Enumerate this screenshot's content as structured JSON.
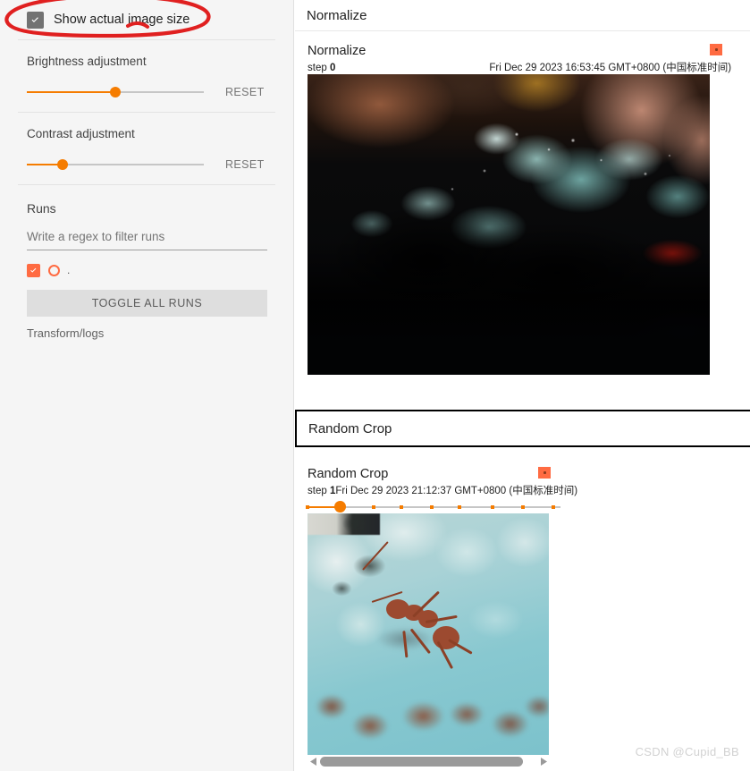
{
  "sidebar": {
    "show_actual_size": {
      "label": "Show actual image size",
      "checked": true
    },
    "brightness": {
      "title": "Brightness adjustment",
      "reset_label": "RESET",
      "value_percent": 50
    },
    "contrast": {
      "title": "Contrast adjustment",
      "reset_label": "RESET",
      "value_percent": 20
    },
    "runs": {
      "title": "Runs",
      "filter_placeholder": "Write a regex to filter runs",
      "filter_value": "",
      "items": [
        {
          "name": ".",
          "checked": true,
          "color": "#ff6b42"
        }
      ],
      "toggle_all_label": "TOGGLE ALL RUNS",
      "transform_label": "Transform/logs"
    },
    "annotation": {
      "shape": "hand-drawn-ellipse",
      "color": "#e02020"
    }
  },
  "main": {
    "normalize_card": {
      "header": "Normalize",
      "title": "Normalize",
      "step_label": "step",
      "step_value": "0",
      "timestamp": "Fri Dec 29 2023 16:53:45 GMT+0800 (中国标准时间)",
      "run_badge_color": "#ff6b42",
      "image_alt": "ants on blue-green ice crystals, dark exposure"
    },
    "random_crop_card": {
      "header": "Random Crop",
      "title": "Random Crop",
      "step_label": "step",
      "step_value": "1",
      "timestamp": "Fri Dec 29 2023 21:12:37 GMT+0800 (中国标准时间)",
      "run_badge_color": "#ff6b42",
      "step_slider": {
        "value_percent": 13,
        "ticks_percent": [
          0,
          13,
          26,
          37,
          49,
          60,
          73,
          85,
          97
        ]
      },
      "image_alt": "close-up red ant on light blue ice crystals",
      "scrollbar": {
        "left_arrow": "◀",
        "right_arrow": "▶",
        "thumb_percent": 94
      }
    }
  },
  "watermark": "CSDN @Cupid_BB",
  "colors": {
    "accent_orange": "#f57c00",
    "run_orange": "#ff6b42",
    "sidebar_bg": "#f5f5f5",
    "annotation_red": "#e02020"
  }
}
